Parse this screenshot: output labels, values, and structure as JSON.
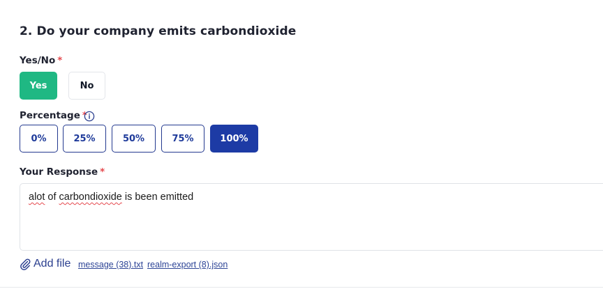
{
  "question": {
    "title": "2. Do your company emits carbondioxide"
  },
  "yes_no": {
    "label": "Yes/No",
    "required_mark": "*",
    "options": [
      "Yes",
      "No"
    ],
    "selected": "Yes"
  },
  "percentage": {
    "label": "Percentage",
    "required_mark": "*",
    "options": [
      "0%",
      "25%",
      "50%",
      "75%",
      "100%"
    ],
    "selected": "100%"
  },
  "response": {
    "label": "Your Response",
    "required_mark": "*",
    "text_part1": "alot",
    "text_part2": " of ",
    "text_part3": "carbondioxide",
    "text_part4": " is been emitted"
  },
  "attachments": {
    "add_file_label": "Add file",
    "files": [
      "message (38).txt",
      "realm-export (8).json"
    ]
  },
  "colors": {
    "selected_green": "#1fb883",
    "selected_blue": "#1d3ba5",
    "outline_blue": "#23398f",
    "required_red": "#e5484d"
  },
  "icons": {
    "info": "info-circle-icon",
    "attach": "paperclip-icon"
  }
}
